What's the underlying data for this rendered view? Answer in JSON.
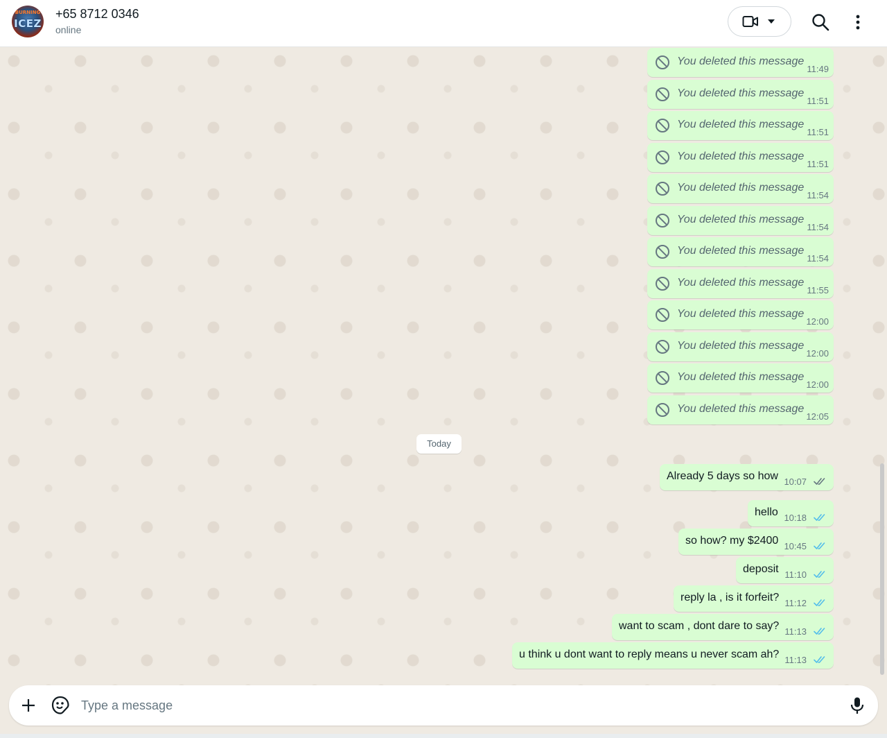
{
  "header": {
    "avatar_text_top": "BURNING",
    "avatar_text_main": "ICEZ",
    "contact_name": "+65 8712 0346",
    "status": "online",
    "icons": [
      "video-camera-icon",
      "chevron-down-icon",
      "search-icon",
      "more-vertical-icon"
    ]
  },
  "deleted_messages": [
    {
      "text": "You deleted this message",
      "time": "11:49"
    },
    {
      "text": "You deleted this message",
      "time": "11:51"
    },
    {
      "text": "You deleted this message",
      "time": "11:51"
    },
    {
      "text": "You deleted this message",
      "time": "11:51"
    },
    {
      "text": "You deleted this message",
      "time": "11:54"
    },
    {
      "text": "You deleted this message",
      "time": "11:54"
    },
    {
      "text": "You deleted this message",
      "time": "11:54"
    },
    {
      "text": "You deleted this message",
      "time": "11:55"
    },
    {
      "text": "You deleted this message",
      "time": "12:00"
    },
    {
      "text": "You deleted this message",
      "time": "12:00"
    },
    {
      "text": "You deleted this message",
      "time": "12:00"
    },
    {
      "text": "You deleted this message",
      "time": "12:05"
    }
  ],
  "date_divider": "Today",
  "messages": [
    {
      "text": "Already 5 days so how",
      "time": "10:07",
      "status": "delivered"
    },
    {
      "text": "hello",
      "time": "10:18",
      "status": "read"
    },
    {
      "text": "so how? my $2400",
      "time": "10:45",
      "status": "read"
    },
    {
      "text": "deposit",
      "time": "11:10",
      "status": "read"
    },
    {
      "text": "reply la , is it forfeit?",
      "time": "11:12",
      "status": "read"
    },
    {
      "text": "want to scam , dont dare to say?",
      "time": "11:13",
      "status": "read"
    },
    {
      "text": "u think u dont want to reply means u never scam ah?",
      "time": "11:13",
      "status": "read"
    }
  ],
  "composer": {
    "placeholder": "Type a message",
    "value": "",
    "icons": [
      "plus-icon",
      "sticker-icon",
      "microphone-icon"
    ]
  },
  "colors": {
    "outgoing_bubble": "#d9fdd3",
    "chat_background": "#efeae2",
    "read_tick": "#53bdeb",
    "delivered_tick": "#667781"
  }
}
